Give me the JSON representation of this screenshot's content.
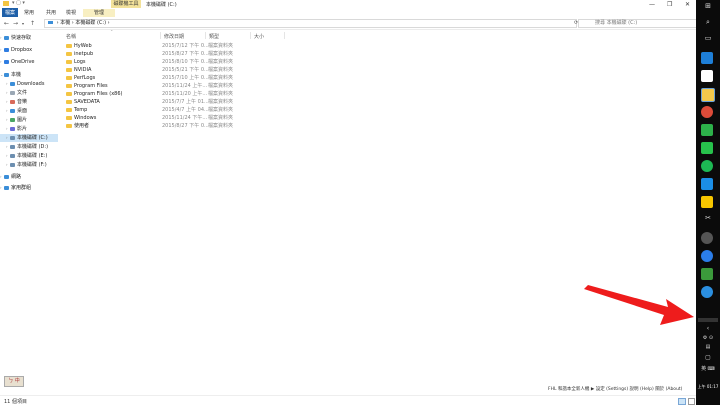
{
  "window": {
    "context_tab_header": "磁碟機工具",
    "title": "本機磁碟 (C:)",
    "controls": [
      "—",
      "❐",
      "✕"
    ]
  },
  "ribbon": {
    "tabs": [
      "檔案",
      "常用",
      "共用",
      "檢視"
    ],
    "context_tab": "管理"
  },
  "address": {
    "path_parts": [
      "本機",
      "本機磁碟 (C:)"
    ],
    "search_placeholder": "搜尋 本機磁碟 (C:)"
  },
  "nav": {
    "items": [
      {
        "label": "快速存取",
        "icon": "star-icon",
        "color": "#3b8ed8"
      },
      {
        "label": "Dropbox",
        "icon": "dropbox-icon",
        "color": "#2f7de1"
      },
      {
        "label": "OneDrive",
        "icon": "cloud-icon",
        "color": "#2f7de1"
      },
      {
        "label": "本機",
        "icon": "computer-icon",
        "color": "#3b8ed8"
      },
      {
        "label": "Downloads",
        "icon": "download-icon",
        "color": "#3b8ed8"
      },
      {
        "label": "文件",
        "icon": "document-icon",
        "color": "#9aa7b4"
      },
      {
        "label": "音樂",
        "icon": "music-icon",
        "color": "#d86a5a"
      },
      {
        "label": "桌面",
        "icon": "desktop-icon",
        "color": "#3b8ed8"
      },
      {
        "label": "圖片",
        "icon": "picture-icon",
        "color": "#4aa564"
      },
      {
        "label": "影片",
        "icon": "video-icon",
        "color": "#6b6bd6"
      },
      {
        "label": "本機磁碟 (C:)",
        "icon": "drive-icon",
        "color": "#6d8fb0"
      },
      {
        "label": "本機磁碟 (D:)",
        "icon": "drive-icon",
        "color": "#6d8fb0"
      },
      {
        "label": "本機磁碟 (E:)",
        "icon": "drive-icon",
        "color": "#6d8fb0"
      },
      {
        "label": "本機磁碟 (F:)",
        "icon": "drive-icon",
        "color": "#6d8fb0"
      },
      {
        "label": "網路",
        "icon": "network-icon",
        "color": "#3b8ed8"
      },
      {
        "label": "家用群組",
        "icon": "homegroup-icon",
        "color": "#3b8ed8"
      }
    ]
  },
  "columns": [
    "名稱",
    "修改日期",
    "類型",
    "大小"
  ],
  "files": [
    {
      "name": "HyWeb",
      "date": "2015/7/12 下午 0...",
      "type": "檔案資料夾"
    },
    {
      "name": "inetpub",
      "date": "2015/8/27 下午 0...",
      "type": "檔案資料夾"
    },
    {
      "name": "Logs",
      "date": "2015/8/10 下午 0...",
      "type": "檔案資料夾"
    },
    {
      "name": "NVIDIA",
      "date": "2015/5/21 下午 0...",
      "type": "檔案資料夾"
    },
    {
      "name": "PerfLogs",
      "date": "2015/7/10 上午 0...",
      "type": "檔案資料夾"
    },
    {
      "name": "Program Files",
      "date": "2015/11/24 上午...",
      "type": "檔案資料夾"
    },
    {
      "name": "Program Files (x86)",
      "date": "2015/11/20 上午...",
      "type": "檔案資料夾"
    },
    {
      "name": "SAVEDATA",
      "date": "2015/7/7 上午 01...",
      "type": "檔案資料夾"
    },
    {
      "name": "Temp",
      "date": "2015/4/7 上午 04...",
      "type": "檔案資料夾"
    },
    {
      "name": "Windows",
      "date": "2015/11/24 下午...",
      "type": "檔案資料夾"
    },
    {
      "name": "使用者",
      "date": "2015/8/27 下午 0...",
      "type": "檔案資料夾"
    }
  ],
  "status": {
    "count": "11 個項目"
  },
  "bottom_help": "FHL 和諧本全新人機 ▶  設定 (Settings)  說明 (Help)  關於 (About)",
  "ime": "ㄅ 中",
  "taskbar": {
    "clock": "上午 01:17",
    "icons": [
      {
        "name": "windows-start-icon",
        "color": "#0b0b0b"
      },
      {
        "name": "search-icon",
        "color": "#0b0b0b"
      },
      {
        "name": "task-view-icon",
        "color": "#0b0b0b"
      },
      {
        "name": "edge-icon",
        "color": "#1e7fd8"
      },
      {
        "name": "store-icon",
        "color": "#ffffff"
      },
      {
        "name": "explorer-icon",
        "color": "#f2c84b"
      },
      {
        "name": "chrome-icon",
        "color": "#dd4b39"
      },
      {
        "name": "evernote-icon",
        "color": "#2db24a"
      },
      {
        "name": "line-icon",
        "color": "#27c24c"
      },
      {
        "name": "spotify-icon",
        "color": "#1db954"
      },
      {
        "name": "play-icon",
        "color": "#1b8ee6"
      },
      {
        "name": "norton-icon",
        "color": "#f7c600"
      },
      {
        "name": "tool-icon",
        "color": "#0b0b0b"
      },
      {
        "name": "steam-icon",
        "color": "#555555"
      },
      {
        "name": "messenger-icon",
        "color": "#2b7de9"
      },
      {
        "name": "green-app-icon",
        "color": "#3b9a3b"
      },
      {
        "name": "blue-app-icon",
        "color": "#2b8fe0"
      }
    ]
  }
}
